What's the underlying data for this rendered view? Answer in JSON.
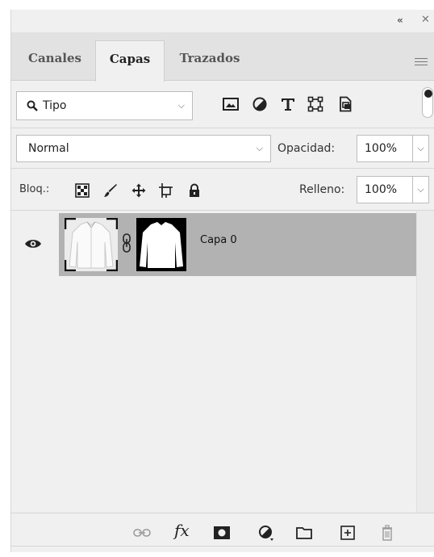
{
  "tabs": [
    {
      "label": "Canales",
      "active": false
    },
    {
      "label": "Capas",
      "active": true
    },
    {
      "label": "Trazados",
      "active": false
    }
  ],
  "top_strip": {
    "collapse_glyph": "«",
    "close_glyph": "✕"
  },
  "filter": {
    "kind_value": "Tipo",
    "icons": [
      "image-filter-icon",
      "adjustment-filter-icon",
      "type-filter-icon",
      "shape-filter-icon",
      "smart-object-filter-icon"
    ]
  },
  "blend": {
    "mode_value": "Normal",
    "opacity_label": "Opacidad:",
    "opacity_value": "100%"
  },
  "lock": {
    "label": "Bloq.:",
    "fill_label": "Relleno:",
    "fill_value": "100%",
    "icons": [
      "lock-transparent-pixels-icon",
      "lock-image-pixels-icon",
      "lock-position-icon",
      "lock-artboard-icon",
      "lock-all-icon"
    ]
  },
  "layers": [
    {
      "name": "Capa 0",
      "visible": true,
      "selected": true,
      "has_mask": true
    }
  ],
  "bottom_toolbar": {
    "fx_label": "fx",
    "icons": [
      "link-layers-icon",
      "layer-style-icon",
      "add-mask-icon",
      "adjustment-layer-icon",
      "new-group-icon",
      "new-layer-icon",
      "delete-layer-icon"
    ]
  },
  "colors": {
    "panel_bg": "#f0f0f0",
    "tabbar_bg": "#e2e2e2",
    "selected_layer_bg": "#b2b2b2",
    "mask_bg": "#000000"
  }
}
